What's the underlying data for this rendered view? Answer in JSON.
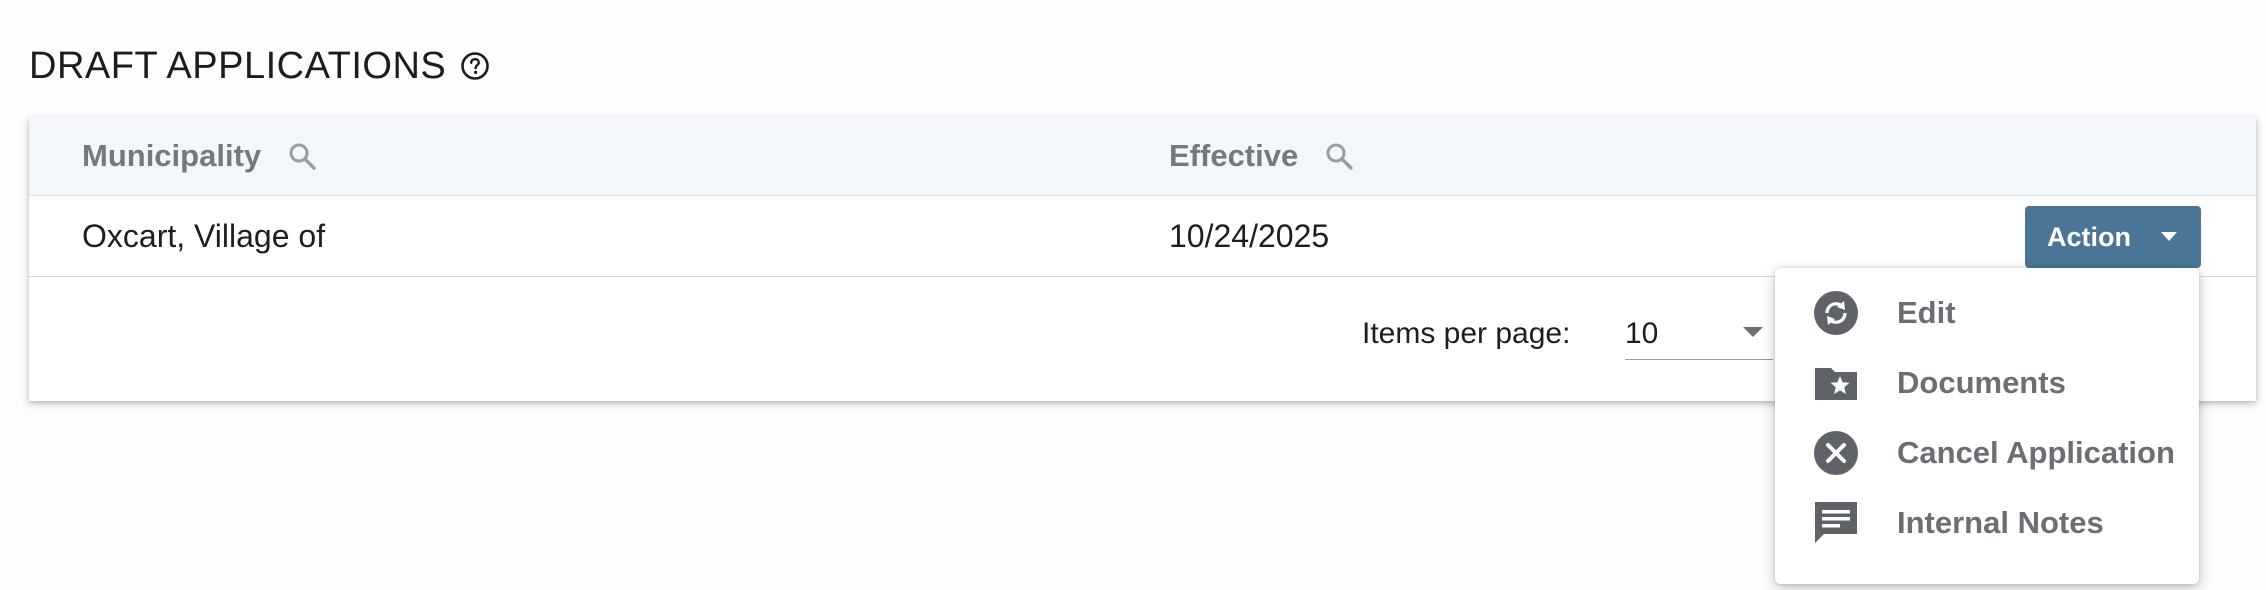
{
  "page": {
    "title": "DRAFT APPLICATIONS",
    "help_icon": "help-circle-icon"
  },
  "table": {
    "columns": [
      {
        "label": "Municipality",
        "filter_icon": "search-icon"
      },
      {
        "label": "Effective",
        "filter_icon": "search-icon"
      }
    ],
    "rows": [
      {
        "municipality": "Oxcart, Village of",
        "effective": "10/24/2025",
        "action_label": "Action"
      }
    ]
  },
  "pagination": {
    "items_per_page_label": "Items per page:",
    "items_per_page_value": "10"
  },
  "action_menu": {
    "items": [
      {
        "label": "Edit",
        "icon": "sync-circle-icon"
      },
      {
        "label": "Documents",
        "icon": "folder-star-icon"
      },
      {
        "label": "Cancel Application",
        "icon": "cancel-circle-icon"
      },
      {
        "label": "Internal Notes",
        "icon": "chat-note-icon"
      }
    ]
  },
  "colors": {
    "accent": "#4a7596",
    "header_bg": "#f3f7fc",
    "icon_gray": "#5f6368",
    "text_muted": "#75797e"
  }
}
